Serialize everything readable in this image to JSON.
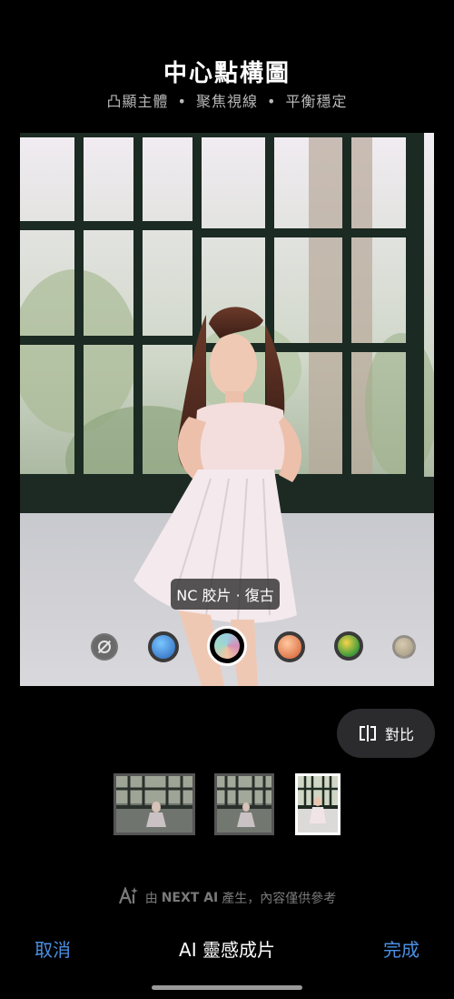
{
  "header": {
    "title": "中心點構圖",
    "subtitle_parts": [
      "凸顯主體",
      "聚焦視線",
      "平衡穩定"
    ],
    "separator": "•"
  },
  "preview": {
    "filter_label": "NC 胶片 · 復古",
    "filters": [
      {
        "icon": "no-filter-icon",
        "selected": false
      },
      {
        "icon": "blue-filter-swatch",
        "selected": false
      },
      {
        "icon": "pastel-film-swatch",
        "selected": true
      },
      {
        "icon": "orange-filter-swatch",
        "selected": false
      },
      {
        "icon": "green-filter-swatch",
        "selected": false
      },
      {
        "icon": "faded-filter-swatch",
        "selected": false
      }
    ]
  },
  "compare_button": {
    "label": "對比",
    "icon": "compare-icon"
  },
  "thumbnails": [
    {
      "name": "variant-1",
      "selected": false
    },
    {
      "name": "variant-2",
      "selected": false
    },
    {
      "name": "variant-3",
      "selected": true
    }
  ],
  "footnote": {
    "prefix": "由",
    "brand": "NEXT AI",
    "suffix": "產生，內容僅供參考",
    "icon": "ai-sparkle-icon"
  },
  "bottom_bar": {
    "cancel_label": "取消",
    "title": "AI 靈感成片",
    "done_label": "完成"
  },
  "colors": {
    "background": "#000000",
    "accent": "#4a90e2",
    "pill_background": "#2b2b2d"
  }
}
